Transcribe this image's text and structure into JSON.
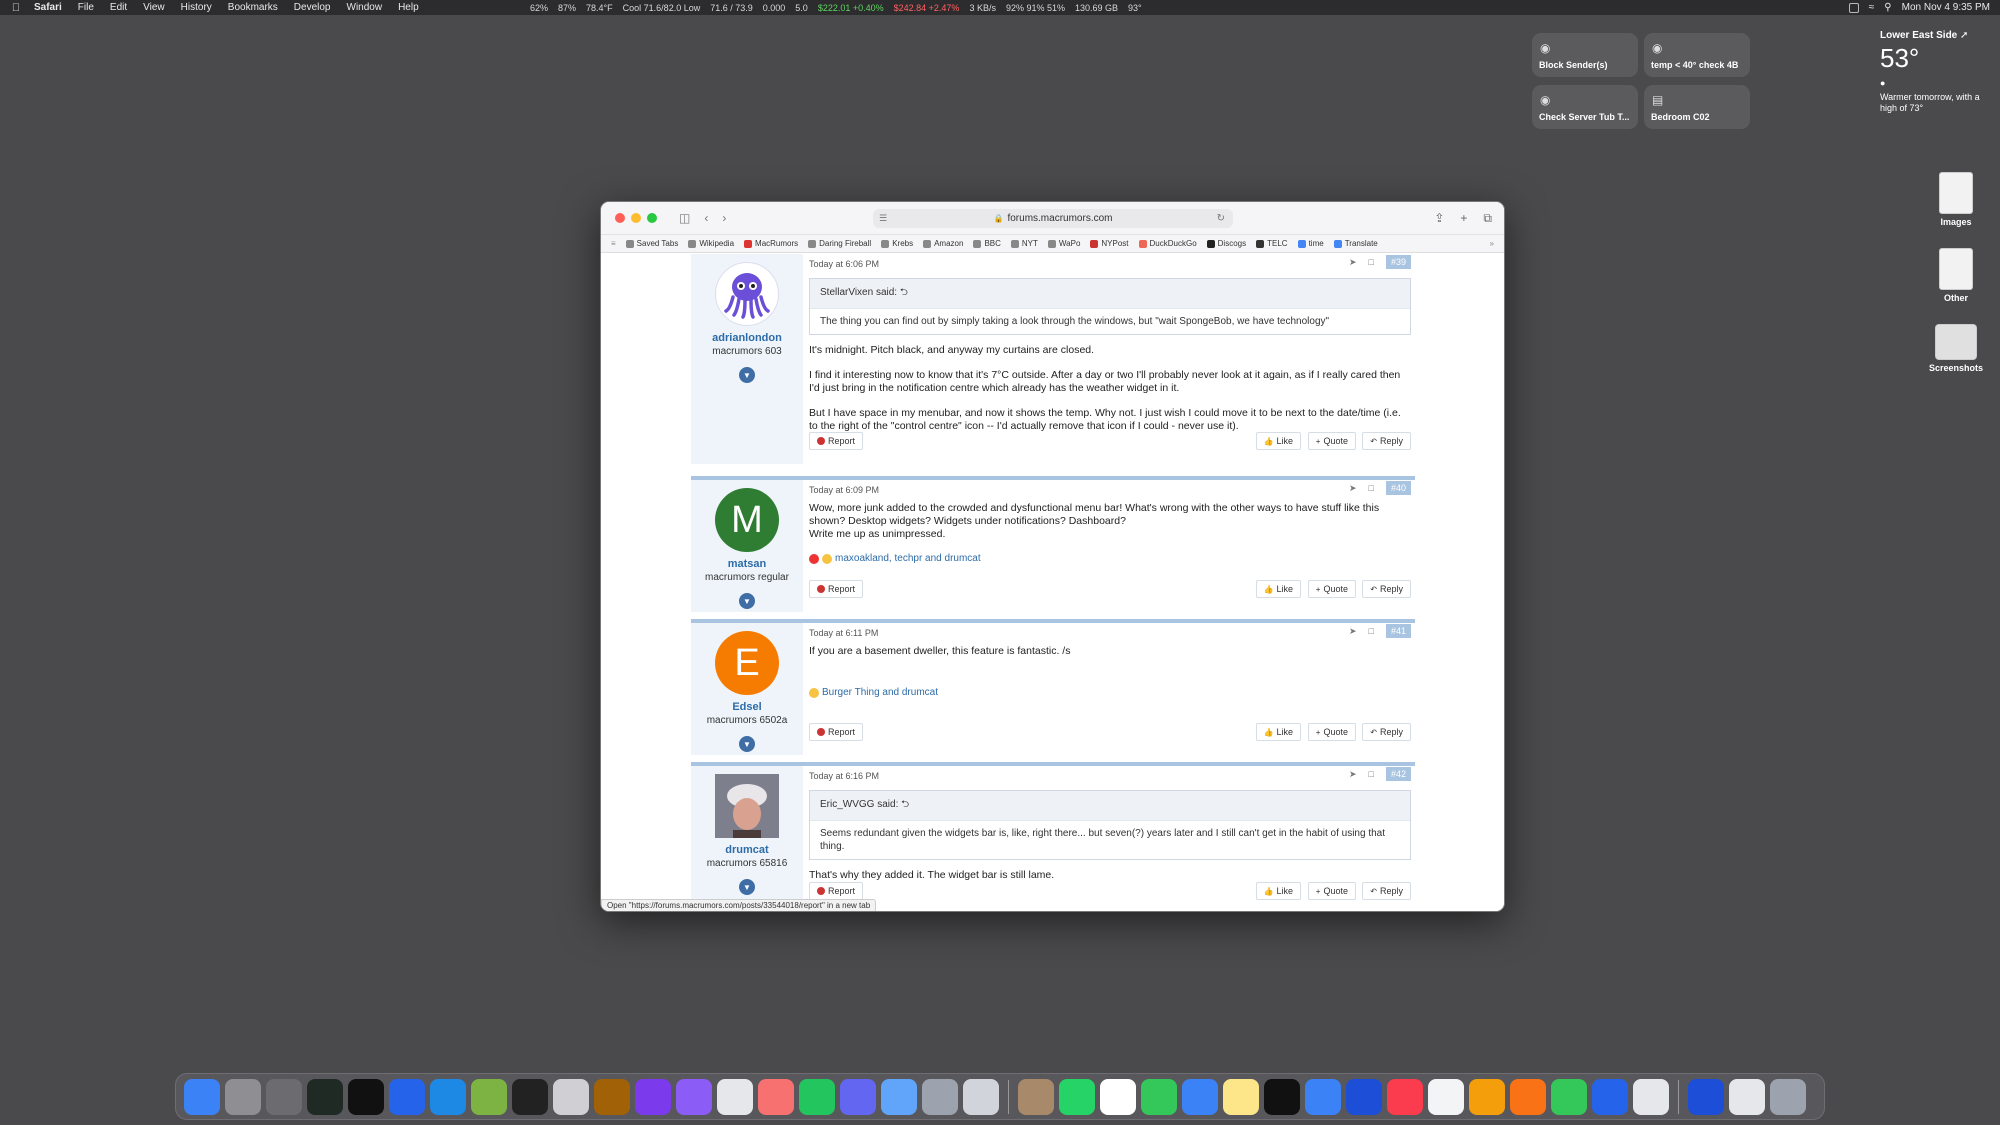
{
  "menubar": {
    "app": "Safari",
    "items": [
      "File",
      "Edit",
      "View",
      "History",
      "Bookmarks",
      "Develop",
      "Window",
      "Help"
    ],
    "stats": [
      "62%",
      "87%",
      "78.4°F",
      "Cool 71.6/82.0 Low",
      "71.6 / 73.9",
      "0.000",
      "5.0",
      "$222.01 +0.40%",
      "$242.84 +2.47%",
      "3 KB/s",
      "92% 91% 51%",
      "130.69 GB",
      "93°"
    ],
    "clock": "Mon Nov 4  9:35 PM"
  },
  "widgets": [
    {
      "label": "Block Sender(s)",
      "icon": "layers-icon"
    },
    {
      "label": "temp < 40° check 4B",
      "icon": "layers-icon"
    },
    {
      "label": "Check Server Tub T...",
      "icon": "layers-icon"
    },
    {
      "label": "Bedroom C02",
      "icon": "bed-icon"
    }
  ],
  "weather": {
    "location": "Lower East Side ➚",
    "temp": "53°",
    "forecast": "Warmer tomorrow, with a high of 73°"
  },
  "desktop": [
    {
      "label": "Images"
    },
    {
      "label": "Other"
    },
    {
      "label": "Screenshots"
    }
  ],
  "browser": {
    "url": "forums.macrumors.com",
    "favorites": [
      "Saved Tabs",
      "Wikipedia",
      "MacRumors",
      "Daring Fireball",
      "Krebs",
      "Amazon",
      "BBC",
      "NYT",
      "WaPo",
      "NYPost",
      "DuckDuckGo",
      "Discogs",
      "TELC",
      "time",
      "Translate"
    ],
    "status_url": "Open \"https://forums.macrumors.com/posts/33544018/report\" in a new tab"
  },
  "posts": [
    {
      "username": "adrianlondon",
      "usertitle": "macrumors 603",
      "time": "Today at 6:06 PM",
      "num": "#39",
      "quote_author": "StellarVixen said: ⮌",
      "quote_text": "The thing you can find out by simply taking a look through the windows, but \"wait SpongeBob, we have technology\"",
      "paragraphs": [
        "It's midnight. Pitch black, and anyway my curtains are closed.",
        "I find it interesting now to know that it's 7°C outside. After a day or two I'll probably never look at it again, as if I really cared then I'd just bring in the notification centre which already has the weather widget in it.",
        "But I have space in my menubar, and now it shows the temp. Why not. I just wish I could move it to be next to the date/time (i.e. to the right of the \"control centre\" icon -- I'd actually remove that icon if I could - never use it)."
      ]
    },
    {
      "username": "matsan",
      "usertitle": "macrumors regular",
      "avatar_letter": "M",
      "time": "Today at 6:09 PM",
      "num": "#40",
      "paragraphs": [
        "Wow, more junk added to the crowded and dysfunctional menu bar! What's wrong with the other ways to have stuff like this shown? Desktop widgets? Widgets under notifications? Dashboard?",
        "Write me up as unimpressed."
      ],
      "reactions": "maxoakland, techpr and drumcat"
    },
    {
      "username": "Edsel",
      "usertitle": "macrumors 6502a",
      "avatar_letter": "E",
      "time": "Today at 6:11 PM",
      "num": "#41",
      "paragraphs": [
        "If you are a basement dweller, this feature is fantastic. /s"
      ],
      "reactions": "Burger Thing and drumcat"
    },
    {
      "username": "drumcat",
      "usertitle": "macrumors 65816",
      "time": "Today at 6:16 PM",
      "num": "#42",
      "quote_author": "Eric_WVGG said: ⮌",
      "quote_text": "Seems redundant given the widgets bar is, like, right there... but seven(?) years later and I still can't get in the habit of using that thing.",
      "paragraphs": [
        "That's why they added it. The widget bar is still lame."
      ]
    }
  ],
  "labels": {
    "report": "Report",
    "like": "Like",
    "quote": "Quote",
    "reply": "Reply"
  },
  "colors": {
    "accent": "#2d6ca8",
    "post_border": "#a9c4e0",
    "green_avatar": "#2e7d32",
    "orange_avatar": "#f57c00"
  }
}
